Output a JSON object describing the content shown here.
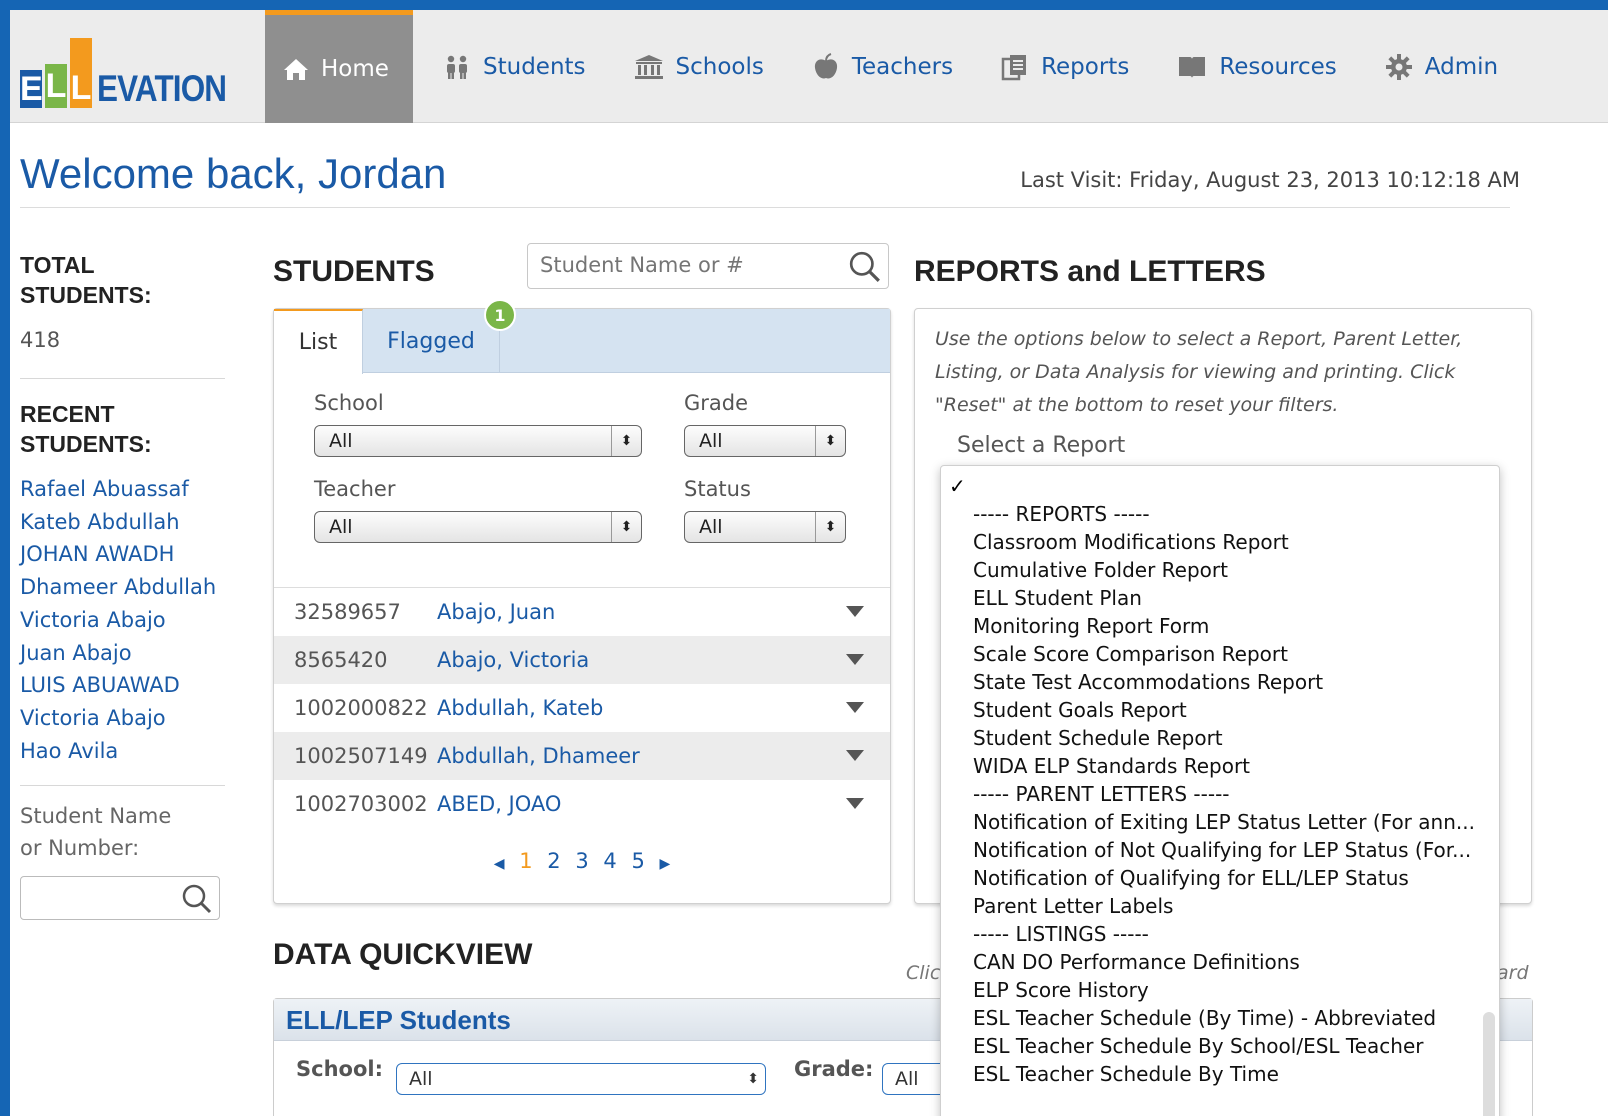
{
  "header": {
    "logo_letters": [
      "E",
      "L",
      "L"
    ],
    "logo_text": "EVATION",
    "nav": [
      {
        "label": "Home",
        "icon": "home-icon"
      },
      {
        "label": "Students",
        "icon": "people-icon"
      },
      {
        "label": "Schools",
        "icon": "building-icon"
      },
      {
        "label": "Teachers",
        "icon": "apple-icon"
      },
      {
        "label": "Reports",
        "icon": "document-icon"
      },
      {
        "label": "Resources",
        "icon": "book-icon"
      },
      {
        "label": "Admin",
        "icon": "gear-icon"
      }
    ]
  },
  "welcome": {
    "title": "Welcome back, Jordan",
    "last_visit": "Last Visit: Friday, August 23, 2013 10:12:18 AM"
  },
  "sidebar": {
    "total_label_1": "TOTAL",
    "total_label_2": "STUDENTS:",
    "total_count": "418",
    "recent_label_1": "RECENT",
    "recent_label_2": "STUDENTS:",
    "recent": [
      "Rafael Abuassaf",
      "Kateb Abdullah",
      "JOHAN AWADH",
      "Dhameer Abdullah",
      "Victoria Abajo",
      "Juan Abajo",
      "LUIS ABUAWAD",
      "Victoria Abajo",
      "Hao Avila"
    ],
    "search_label_1": "Student Name",
    "search_label_2": "or Number:"
  },
  "students": {
    "title": "STUDENTS",
    "search_placeholder": "Student Name or #",
    "tabs": {
      "list": "List",
      "flagged": "Flagged",
      "flagged_count": "1"
    },
    "filters": {
      "school_label": "School",
      "school_value": "All",
      "grade_label": "Grade",
      "grade_value": "All",
      "teacher_label": "Teacher",
      "teacher_value": "All",
      "status_label": "Status",
      "status_value": "All"
    },
    "rows": [
      {
        "id": "32589657",
        "name": "Abajo, Juan"
      },
      {
        "id": "8565420",
        "name": "Abajo, Victoria"
      },
      {
        "id": "1002000822",
        "name": "Abdullah, Kateb"
      },
      {
        "id": "1002507149",
        "name": "Abdullah, Dhameer"
      },
      {
        "id": "1002703002",
        "name": "ABED, JOAO"
      }
    ],
    "pages": [
      "1",
      "2",
      "3",
      "4",
      "5"
    ]
  },
  "quickview": {
    "title": "DATA QUICKVIEW",
    "panel_title": "ELL/LEP Students",
    "school_label": "School:",
    "school_value": "All",
    "grade_label": "Grade:",
    "grade_value": "All",
    "note_left": "Clic",
    "note_right": "ard"
  },
  "reports": {
    "title": "REPORTS and LETTERS",
    "description": "Use the options below to select a Report, Parent Letter, Listing, or Data Analysis for viewing and printing. Click \"Reset\" at the bottom to reset your filters.",
    "select_label": "Select a Report",
    "check": "✓",
    "options": [
      "----- REPORTS -----",
      "Classroom Modifications Report",
      "Cumulative Folder Report",
      "ELL Student Plan",
      "Monitoring Report Form",
      "Scale Score Comparison Report",
      "State Test Accommodations Report",
      "Student Goals Report",
      "Student Schedule Report",
      "WIDA ELP Standards Report",
      "----- PARENT LETTERS -----",
      "Notification of Exiting LEP Status Letter (For ann...",
      "Notification of Not Qualifying for LEP Status (For...",
      "Notification of Qualifying for ELL/LEP Status",
      "Parent Letter Labels",
      "----- LISTINGS -----",
      "CAN DO Performance Definitions",
      "ELP Score History",
      "ESL Teacher Schedule (By Time) - Abbreviated",
      "ESL Teacher Schedule By School/ESL Teacher",
      "ESL Teacher Schedule By Time"
    ]
  },
  "colors": {
    "brand_blue": "#1a5aa6",
    "accent_orange": "#f39a1e",
    "accent_green": "#7ab648",
    "frame_blue": "#1565b4"
  }
}
